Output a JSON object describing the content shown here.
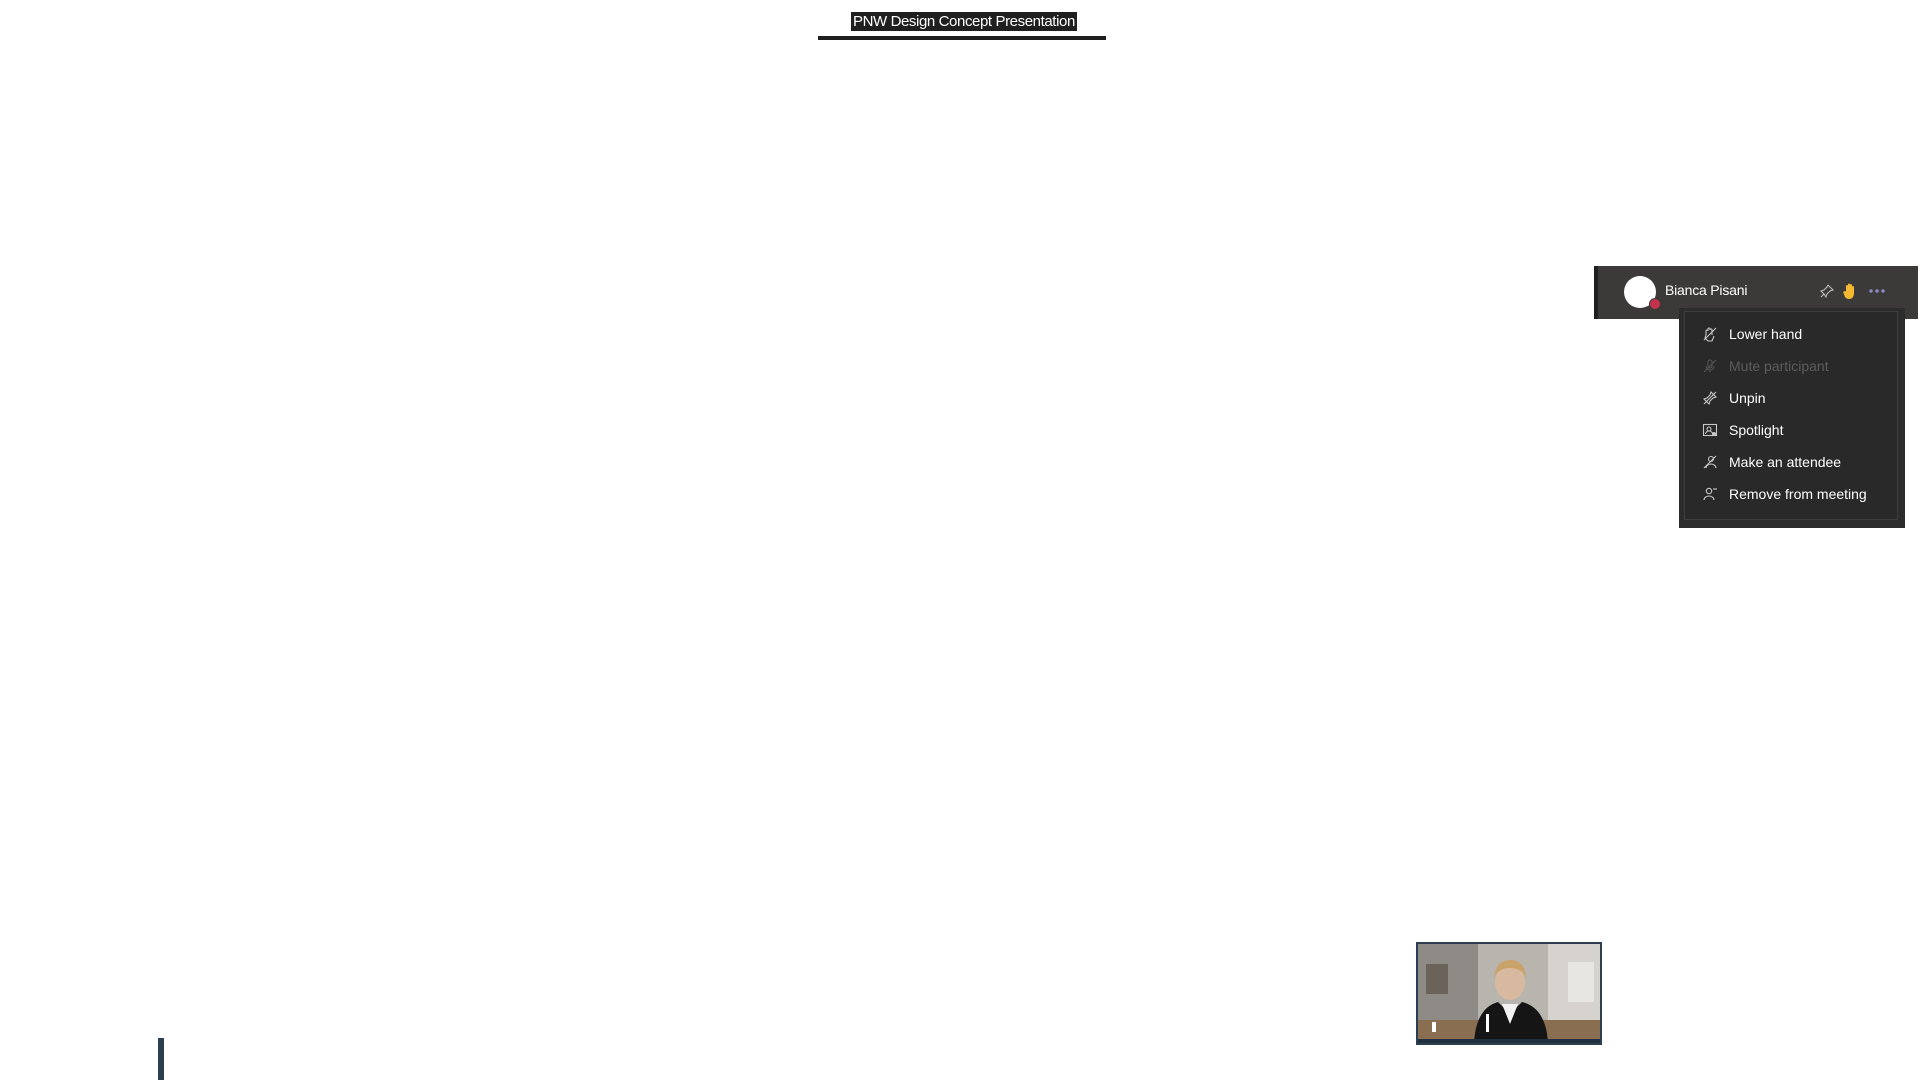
{
  "meeting": {
    "title": "PNW Design Concept Presentation"
  },
  "participant": {
    "name": "Bianca Pisani",
    "avatar_icon": "avatar-icon",
    "status_color": "#c4314b",
    "hand_color": "#f5b833"
  },
  "context_menu": {
    "items": [
      {
        "label": "Lower hand",
        "icon": "lower-hand-icon",
        "enabled": true
      },
      {
        "label": "Mute participant",
        "icon": "mic-off-icon",
        "enabled": false
      },
      {
        "label": "Unpin",
        "icon": "unpin-icon",
        "enabled": true
      },
      {
        "label": "Spotlight",
        "icon": "spotlight-icon",
        "enabled": true
      },
      {
        "label": "Make an attendee",
        "icon": "make-attendee-icon",
        "enabled": true
      },
      {
        "label": "Remove from meeting",
        "icon": "remove-person-icon",
        "enabled": true
      }
    ]
  },
  "colors": {
    "menu_bg": "#292929",
    "row_bg": "#3b3a39",
    "accent": "#8b8cc7"
  }
}
